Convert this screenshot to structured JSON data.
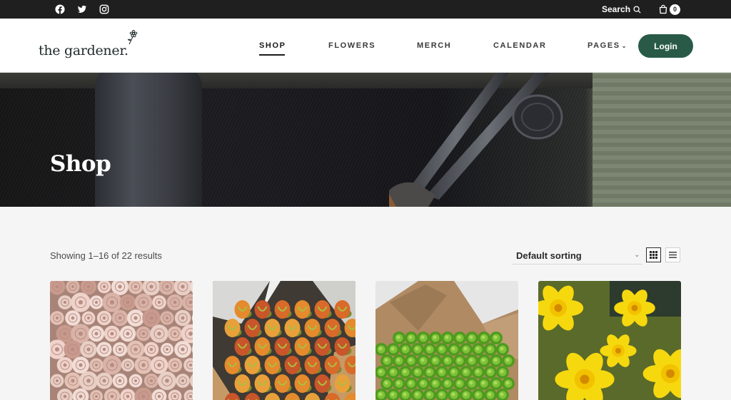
{
  "topbar": {
    "social": [
      "facebook-icon",
      "twitter-icon",
      "instagram-icon"
    ],
    "search_label": "Search",
    "cart_count": "0"
  },
  "header": {
    "logo_text": "the gardener.",
    "nav": [
      {
        "label": "SHOP",
        "active": true
      },
      {
        "label": "FLOWERS"
      },
      {
        "label": "MERCH"
      },
      {
        "label": "CALENDAR"
      },
      {
        "label": "PAGES",
        "has_dropdown": true
      }
    ],
    "login_label": "Login"
  },
  "hero": {
    "title": "Shop"
  },
  "shop": {
    "results_text": "Showing 1–16 of 22 results",
    "sort_selected": "Default sorting",
    "view_modes": [
      "grid-view-icon",
      "list-view-icon"
    ],
    "products": [
      {
        "image": "pink-roses-image"
      },
      {
        "image": "orange-tulips-image"
      },
      {
        "image": "green-chrysanthemums-image"
      },
      {
        "image": "yellow-daffodils-image"
      }
    ]
  },
  "colors": {
    "topbar_bg": "#1f1f1f",
    "accent_green": "#295a48",
    "page_bg": "#f5f5f5"
  }
}
